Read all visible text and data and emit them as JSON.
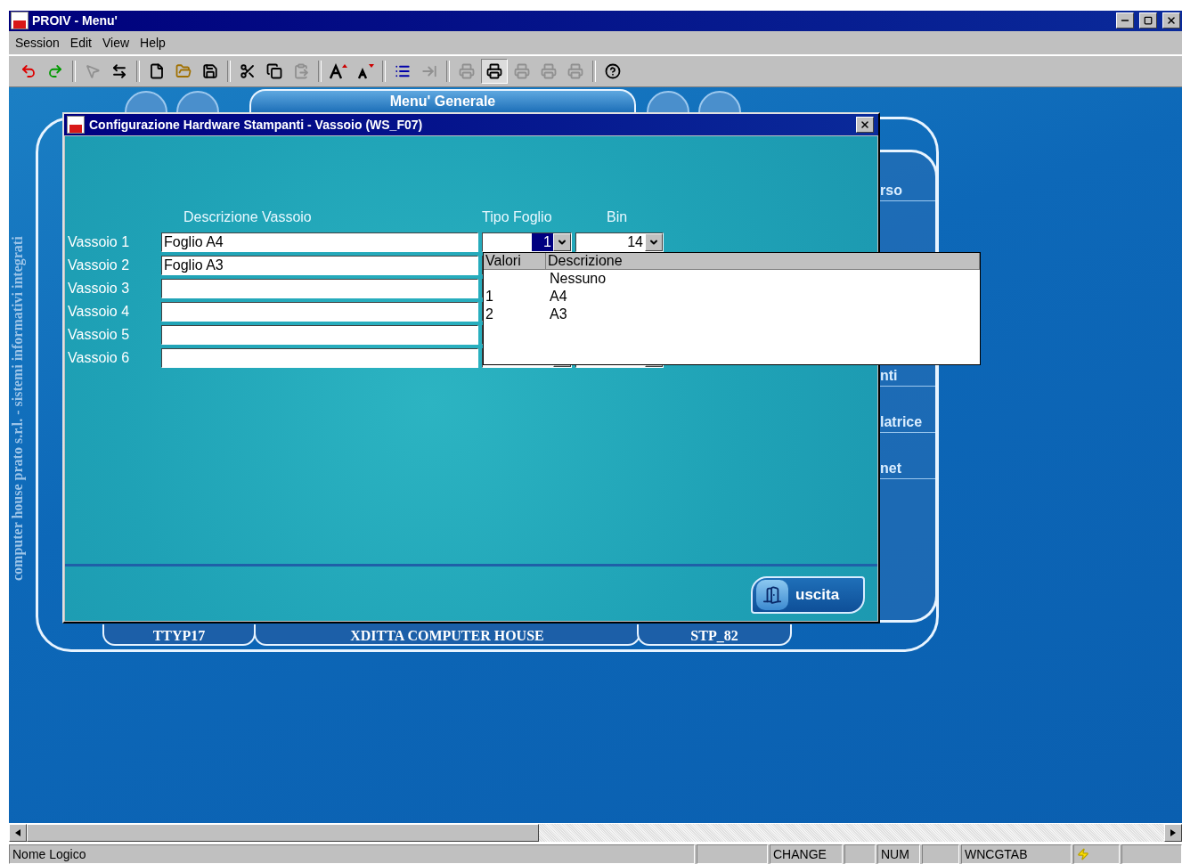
{
  "window": {
    "title": "PROIV - Menu'"
  },
  "menu": [
    {
      "label": "Session"
    },
    {
      "label": "Edit"
    },
    {
      "label": "View"
    },
    {
      "label": "Help"
    }
  ],
  "toolbar": [
    {
      "kind": "undo",
      "disabled": false,
      "pressed": false
    },
    {
      "kind": "redo",
      "disabled": false,
      "pressed": false
    },
    {
      "kind": "sep"
    },
    {
      "kind": "pointer",
      "disabled": true,
      "pressed": false
    },
    {
      "kind": "arrows",
      "disabled": false,
      "pressed": false
    },
    {
      "kind": "sep"
    },
    {
      "kind": "new",
      "disabled": false,
      "pressed": false
    },
    {
      "kind": "open",
      "disabled": false,
      "pressed": false
    },
    {
      "kind": "save",
      "disabled": false,
      "pressed": false
    },
    {
      "kind": "sep"
    },
    {
      "kind": "cut",
      "disabled": false,
      "pressed": false
    },
    {
      "kind": "copy",
      "disabled": false,
      "pressed": false
    },
    {
      "kind": "paste",
      "disabled": true,
      "pressed": false
    },
    {
      "kind": "sep"
    },
    {
      "kind": "fontup",
      "disabled": false,
      "pressed": false
    },
    {
      "kind": "fontdown",
      "disabled": false,
      "pressed": false
    },
    {
      "kind": "sep"
    },
    {
      "kind": "form",
      "disabled": false,
      "pressed": false
    },
    {
      "kind": "tab",
      "disabled": true,
      "pressed": false
    },
    {
      "kind": "sep"
    },
    {
      "kind": "print",
      "disabled": true,
      "pressed": false
    },
    {
      "kind": "print",
      "disabled": false,
      "pressed": true
    },
    {
      "kind": "print",
      "disabled": true,
      "pressed": false
    },
    {
      "kind": "print",
      "disabled": true,
      "pressed": false
    },
    {
      "kind": "print",
      "disabled": true,
      "pressed": false
    },
    {
      "kind": "sep"
    },
    {
      "kind": "help",
      "disabled": false,
      "pressed": false
    }
  ],
  "background": {
    "header": "Menu' Generale",
    "vertical_text": "computer house prato s.r.l. - sistemi informativi integrati",
    "side_items": [
      {
        "label": "rso"
      },
      {
        "label": "nti"
      },
      {
        "label": "latrice"
      },
      {
        "label": "net"
      }
    ],
    "bottom_tabs": [
      {
        "label": "TTYP17"
      },
      {
        "label": "XDITTA COMPUTER HOUSE"
      },
      {
        "label": "STP_82"
      }
    ]
  },
  "dialog": {
    "title": "Configurazione Hardware Stampanti - Vassoio (WS_F07)",
    "columns": [
      "Descrizione Vassoio",
      "Tipo Foglio",
      "Bin"
    ],
    "rows": [
      {
        "label": "Vassoio 1",
        "description": "Foglio A4",
        "tipo": "1",
        "bin": "14"
      },
      {
        "label": "Vassoio 2",
        "description": "Foglio A3"
      },
      {
        "label": "Vassoio 3"
      },
      {
        "label": "Vassoio 4"
      },
      {
        "label": "Vassoio 5"
      },
      {
        "label": "Vassoio 6"
      }
    ],
    "dropdown": {
      "columns": [
        "Valori",
        "Descrizione"
      ],
      "options": [
        {
          "description": "Nessuno"
        },
        {
          "value": "1",
          "description": "A4"
        },
        {
          "value": "2",
          "description": "A3"
        }
      ]
    },
    "exit_button": "uscita"
  },
  "status_bar": {
    "panes": [
      {
        "kind": "text",
        "text": "Nome Logico"
      },
      {
        "kind": "blank"
      },
      {
        "kind": "text",
        "text": "CHANGE"
      },
      {
        "kind": "blank"
      },
      {
        "kind": "text",
        "text": "NUM"
      },
      {
        "kind": "blank"
      },
      {
        "kind": "text",
        "text": "WNCGTAB"
      },
      {
        "kind": "icon"
      },
      {
        "kind": "blank"
      }
    ]
  }
}
